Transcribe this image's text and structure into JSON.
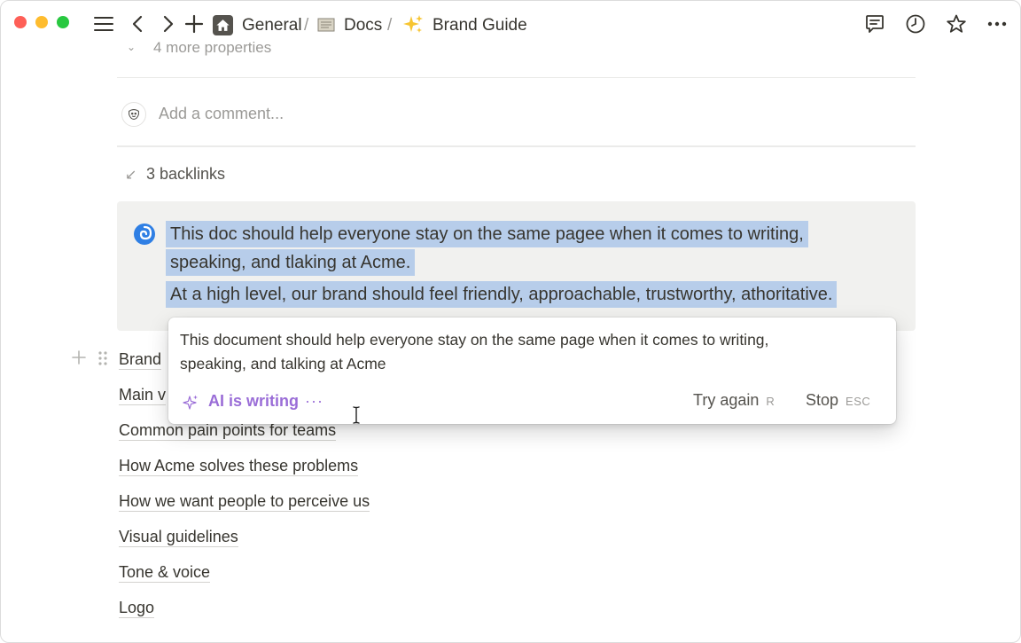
{
  "breadcrumb": {
    "items": [
      "General",
      "Docs",
      "Brand Guide"
    ],
    "separator": "/"
  },
  "properties": {
    "more_label": "4 more properties"
  },
  "comment": {
    "placeholder": "Add a comment..."
  },
  "backlinks": {
    "label": "3 backlinks"
  },
  "callout": {
    "lines": [
      "This doc should help everyone stay on the same pagee when it comes to writing,",
      "speaking, and tlaking at Acme.",
      "At a high level, our brand should feel friendly, approachable, trustworthy, athoritative."
    ],
    "highlight_color": "#b7cdea",
    "background": "#f1f1ef"
  },
  "ai_popup": {
    "suggestion_line1": "This document should help everyone stay on the same page when it comes to writing,",
    "suggestion_line2": "speaking, and talking at Acme",
    "status": "AI is writing",
    "dots": "···",
    "try_again_label": "Try again",
    "try_again_key": "R",
    "stop_label": "Stop",
    "stop_key": "ESC",
    "accent_color": "#9a6dd7"
  },
  "links": [
    "Brand",
    "Main v",
    "Common pain points for teams",
    "How Acme solves these problems",
    "How we want people to perceive us",
    "Visual guidelines",
    "Tone & voice",
    "Logo"
  ],
  "icons": {
    "menu": "menu-icon",
    "back": "chevron-left-icon",
    "forward": "chevron-right-icon",
    "new": "plus-icon",
    "home": "home-icon",
    "comments": "comment-icon",
    "history": "clock-icon",
    "favorite": "star-icon",
    "more": "more-horizontal-icon"
  }
}
